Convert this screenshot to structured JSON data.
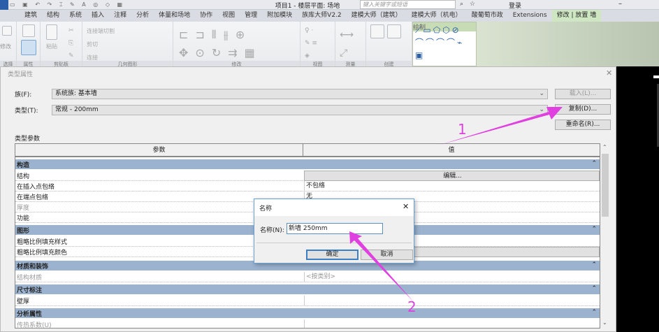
{
  "app": {
    "title": "项目1 - 楼层平面: 场地",
    "search_placeholder": "键入关键字或短语",
    "login": "登录"
  },
  "tabs": [
    "建筑",
    "结构",
    "系统",
    "插入",
    "注释",
    "分析",
    "体量和场地",
    "协作",
    "视图",
    "管理",
    "附加模块",
    "族库大师V2.2",
    "建模大师（建筑）",
    "建模大师（机电）",
    "酸葡萄市政",
    "Extensions",
    "修改 | 放置 墙"
  ],
  "active_tab": "修改 | 放置 墙",
  "ribbon": {
    "modify": "修改",
    "paste": "粘贴",
    "join_cut": "连接端切割",
    "cut": "剪切",
    "join": "连接",
    "groups": [
      "选择",
      "属性",
      "剪贴板",
      "几何图形",
      "修改",
      "视图",
      "测量",
      "创建",
      "绘制"
    ]
  },
  "dialog": {
    "title": "类型属性",
    "family_label": "族(F):",
    "family_value": "系统族: 基本墙",
    "type_label": "类型(T):",
    "type_value": "常规 - 200mm",
    "load_button": "载入(L)...",
    "duplicate_button": "复制(D)...",
    "rename_button": "重命名(R)...",
    "params_label": "类型参数",
    "col_param": "参数",
    "col_value": "值"
  },
  "rows": [
    {
      "group": true,
      "p": "构造"
    },
    {
      "p": "结构",
      "v": "编辑...",
      "button": true
    },
    {
      "p": "在插入点包络",
      "v": "不包络"
    },
    {
      "p": "在端点包络",
      "v": "无"
    },
    {
      "p": "厚度",
      "v": "",
      "gray": true
    },
    {
      "p": "功能",
      "v": ""
    },
    {
      "group": true,
      "p": "图形"
    },
    {
      "p": "粗略比例填充样式",
      "v": ""
    },
    {
      "p": "粗略比例填充颜色",
      "v": "",
      "button": true
    },
    {
      "group": true,
      "p": "材质和装饰"
    },
    {
      "p": "结构材质",
      "v": "<按类别>",
      "gray": true
    },
    {
      "group": true,
      "p": "尺寸标注"
    },
    {
      "p": "壁厚",
      "v": ""
    },
    {
      "group": true,
      "p": "分析属性"
    },
    {
      "p": "传热系数(U)",
      "v": "",
      "gray": true
    }
  ],
  "name_dialog": {
    "title": "名称",
    "label": "名称(N):",
    "value": "新墙 250mm",
    "ok": "确定",
    "cancel": "取消"
  },
  "annotations": {
    "one": "1",
    "two": "2",
    "color": "#e040e0"
  }
}
